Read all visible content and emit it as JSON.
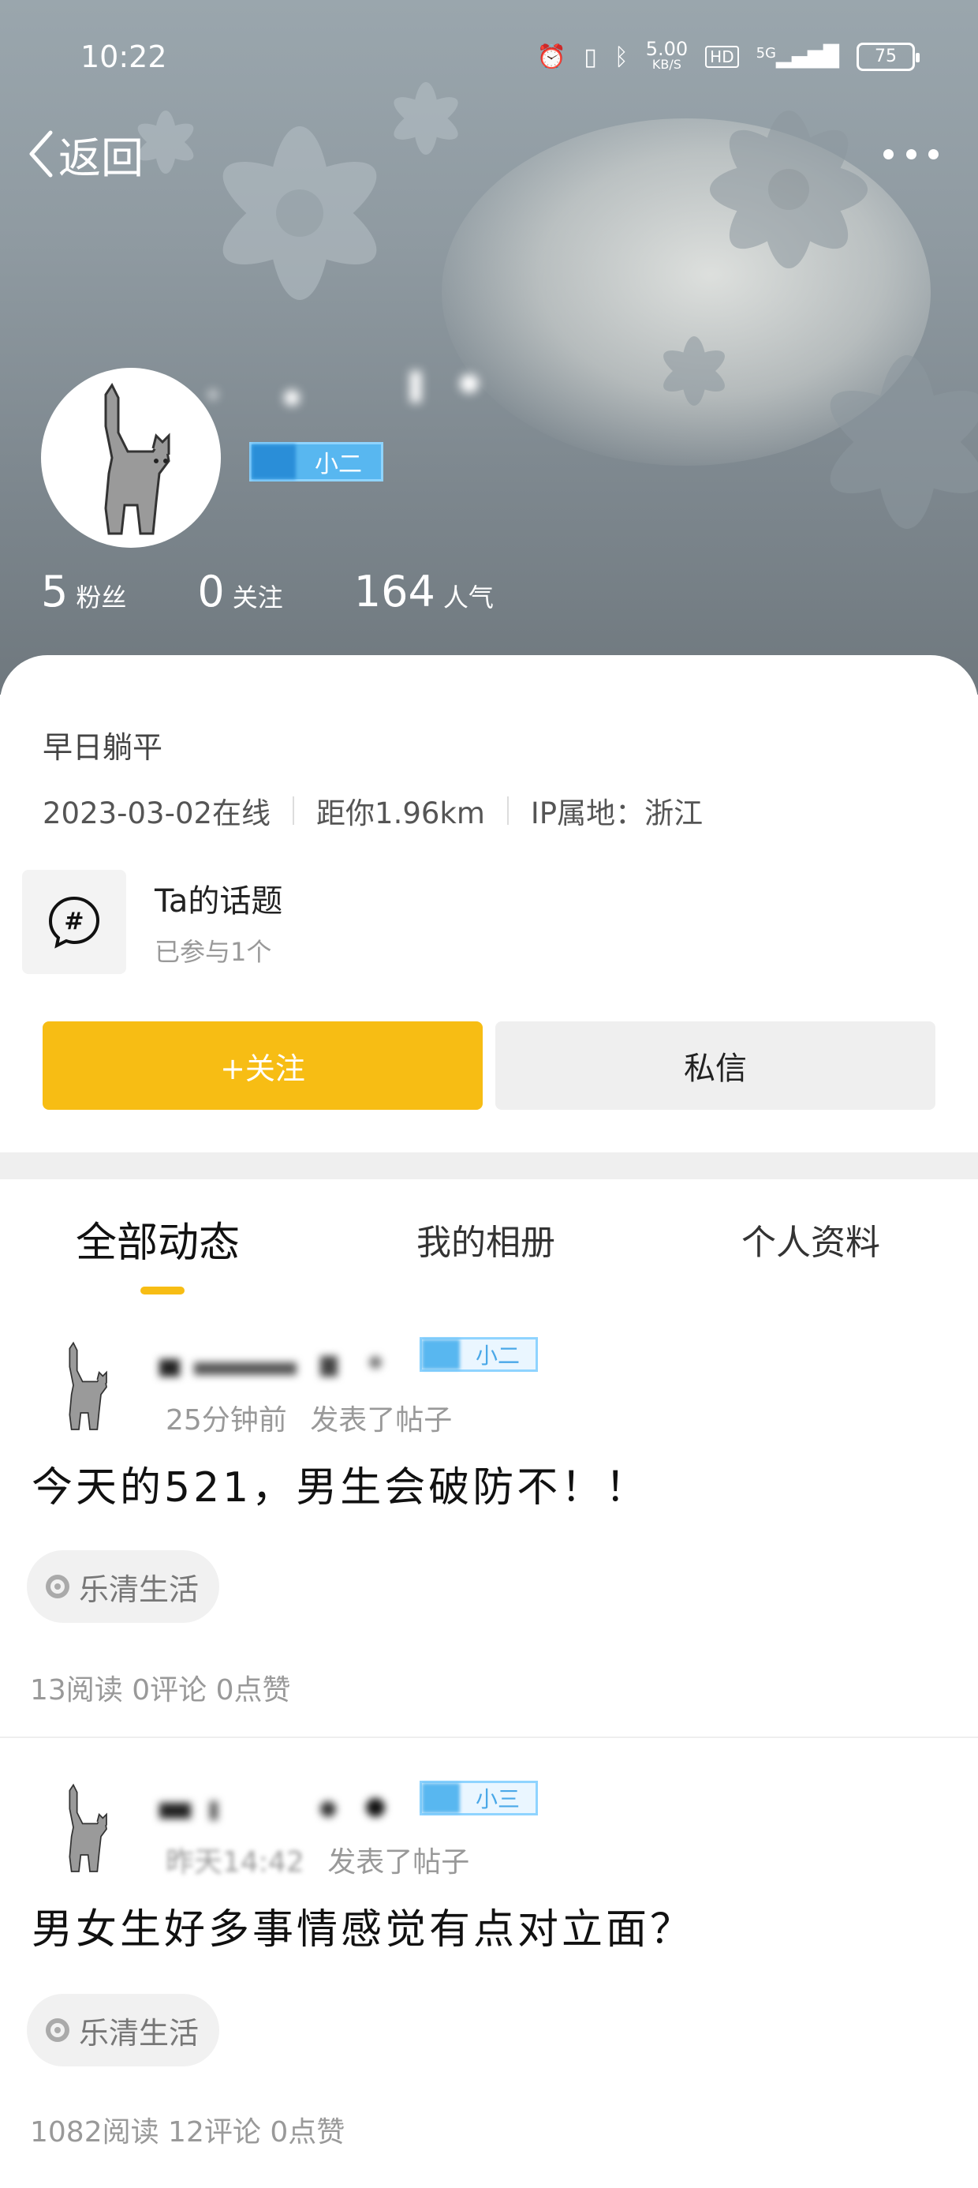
{
  "status_bar": {
    "time": "10:22",
    "net_speed_value": "5.00",
    "net_speed_unit": "KB/S",
    "hd": "HD",
    "network": "5G",
    "battery": "75"
  },
  "nav": {
    "back_label": "返回"
  },
  "profile": {
    "level_badge": "小二",
    "stats": [
      {
        "value": "5",
        "label": "粉丝"
      },
      {
        "value": "0",
        "label": "关注"
      },
      {
        "value": "164",
        "label": "人气"
      }
    ],
    "signature": "早日躺平",
    "last_online": "2023-03-02在线",
    "distance": "距你1.96km",
    "ip_location": "IP属地：浙江",
    "topics": {
      "title": "Ta的话题",
      "subtitle": "已参与1个"
    },
    "follow_label": "+关注",
    "message_label": "私信"
  },
  "tabs": [
    {
      "label": "全部动态",
      "active": true
    },
    {
      "label": "我的相册",
      "active": false
    },
    {
      "label": "个人资料",
      "active": false
    }
  ],
  "posts": [
    {
      "badge": "小二",
      "time": "25分钟前",
      "action": "发表了帖子",
      "title": "今天的521，男生会破防不！！",
      "tag": "乐清生活",
      "stats": "13阅读 0评论 0点赞"
    },
    {
      "badge": "小三",
      "time": "昨天14:42",
      "action": "发表了帖子",
      "title": "男女生好多事情感觉有点对立面？",
      "tag": "乐清生活",
      "stats": "1082阅读 12评论 0点赞"
    }
  ],
  "colors": {
    "accent": "#f7bd14",
    "badge_blue": "#58b7f0"
  }
}
